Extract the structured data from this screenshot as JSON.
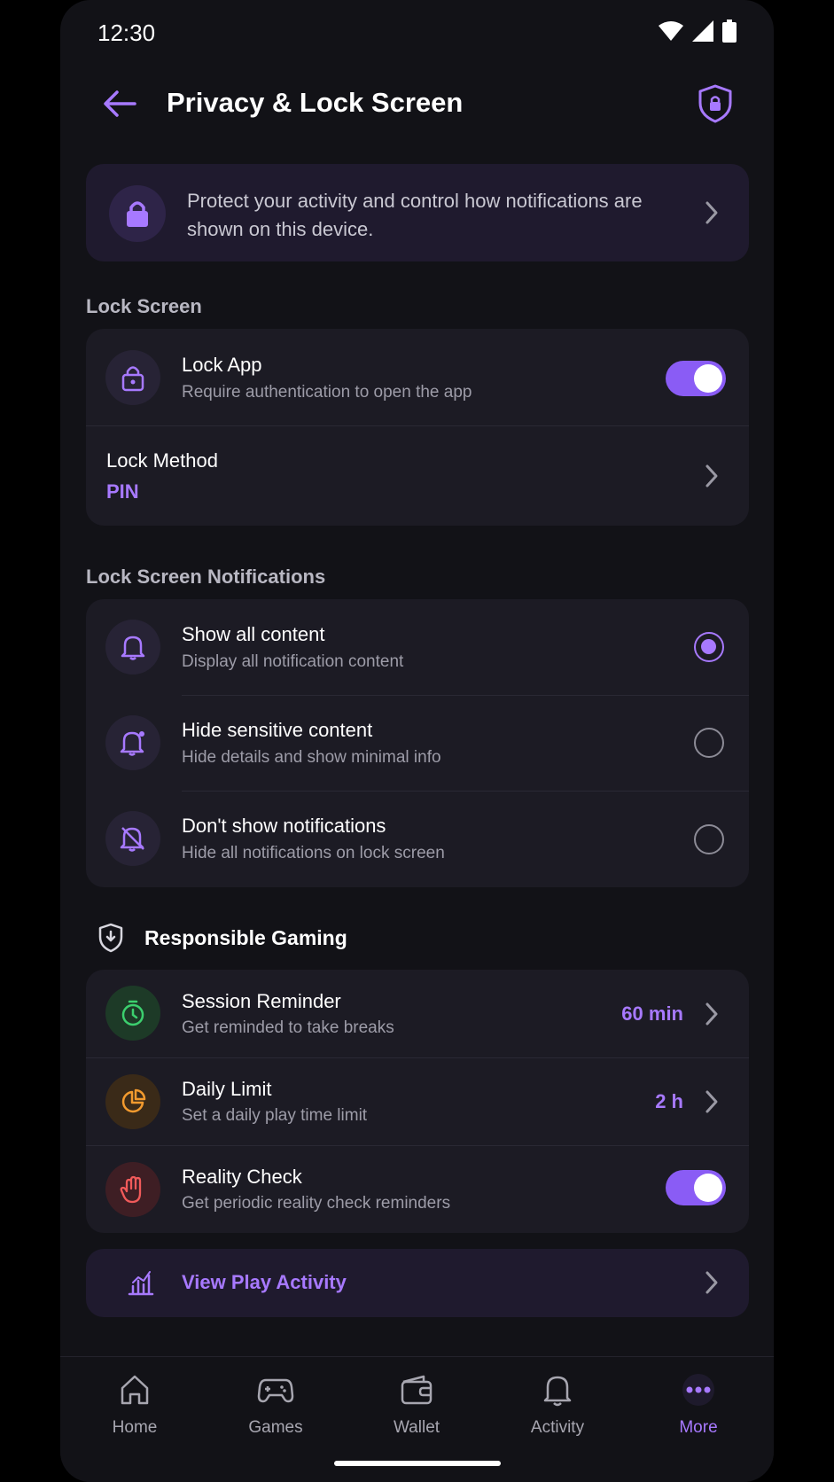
{
  "status": {
    "time": "12:30"
  },
  "header": {
    "title": "Privacy & Lock Screen"
  },
  "info_banner": {
    "text": "Protect your activity and control how notifications are shown on this device."
  },
  "lock_screen": {
    "section_title": "Lock Screen",
    "lock_app": {
      "title": "Lock App",
      "subtitle": "Require authentication to open the app",
      "enabled": true
    },
    "lock_method": {
      "title": "Lock Method",
      "value": "PIN"
    }
  },
  "notifications": {
    "section_title": "Lock Screen Notifications",
    "options": [
      {
        "title": "Show all content",
        "subtitle": "Display all notification content",
        "selected": true
      },
      {
        "title": "Hide sensitive content",
        "subtitle": "Hide details and show minimal info",
        "selected": false
      },
      {
        "title": "Don't show notifications",
        "subtitle": "Hide all notifications on lock screen",
        "selected": false
      }
    ]
  },
  "gaming": {
    "section_title": "Responsible Gaming",
    "session_reminder": {
      "title": "Session Reminder",
      "subtitle": "Get reminded to take breaks",
      "value": "60 min"
    },
    "daily_limit": {
      "title": "Daily Limit",
      "subtitle": "Set a daily play time limit",
      "value": "2 h"
    },
    "reality_check": {
      "title": "Reality Check",
      "subtitle": "Get periodic reality check reminders",
      "enabled": true
    }
  },
  "activity_link": {
    "label": "View Play Activity"
  },
  "nav": {
    "items": [
      {
        "label": "Home",
        "icon": "home-icon"
      },
      {
        "label": "Games",
        "icon": "gamepad-icon"
      },
      {
        "label": "Wallet",
        "icon": "wallet-icon"
      },
      {
        "label": "Activity",
        "icon": "bell-icon"
      },
      {
        "label": "More",
        "icon": "more-dots-icon"
      }
    ],
    "active": "More"
  },
  "colors": {
    "accent": "#a779ff",
    "background": "#121217",
    "card": "#1c1b24",
    "green": "#3ccf6e",
    "orange": "#f29a2e",
    "red": "#f05a5a"
  }
}
